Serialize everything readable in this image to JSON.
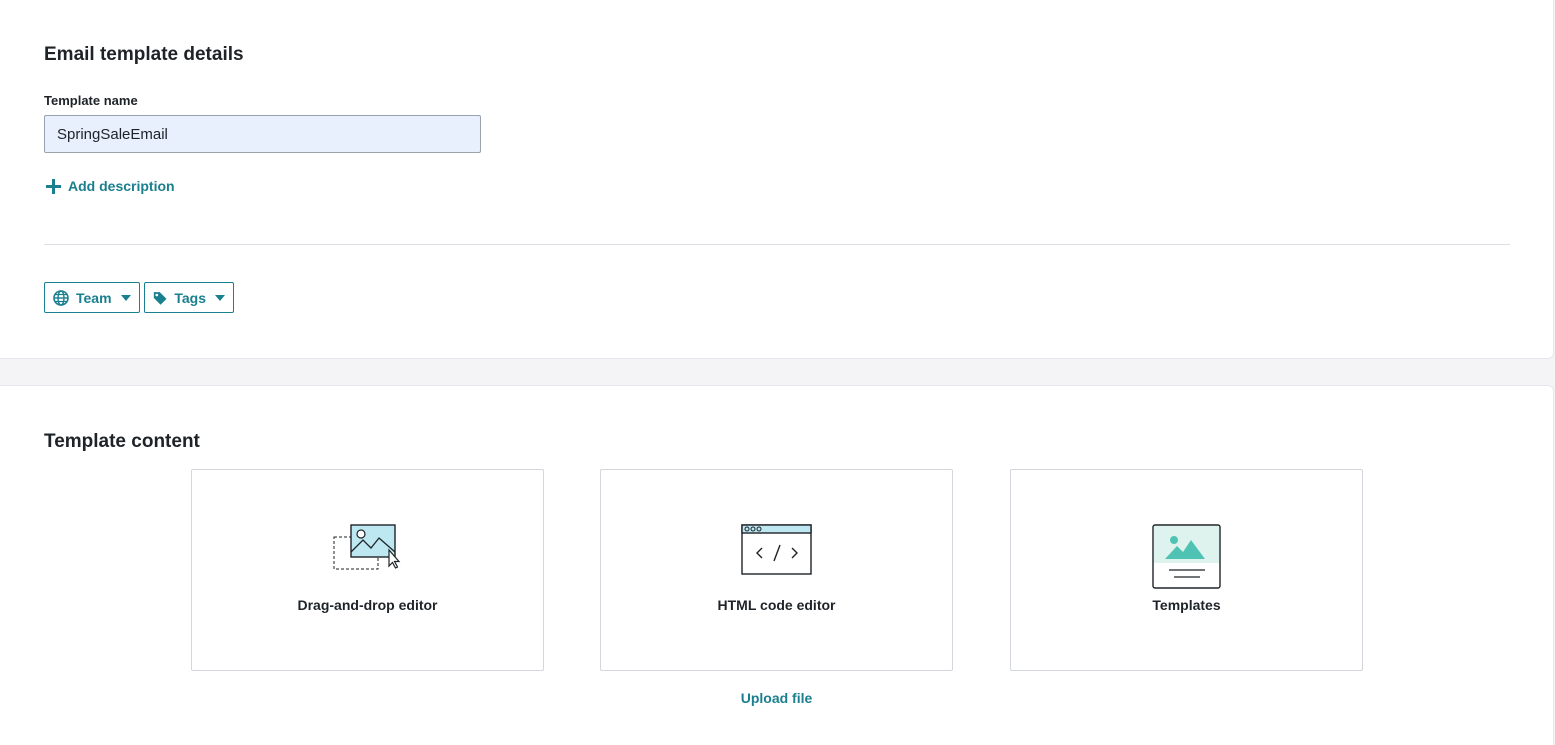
{
  "details": {
    "title": "Email template details",
    "template_name_label": "Template name",
    "template_name_value": "SpringSaleEmail",
    "add_description_label": "Add description",
    "team_label": "Team",
    "tags_label": "Tags"
  },
  "content": {
    "title": "Template content",
    "options": [
      {
        "label": "Drag-and-drop editor",
        "icon": "drag-drop-image-icon"
      },
      {
        "label": "HTML code editor",
        "icon": "code-window-icon"
      },
      {
        "label": "Templates",
        "icon": "template-image-icon"
      }
    ],
    "upload_label": "Upload file"
  },
  "colors": {
    "accent": "#1a7f8e",
    "icon_fill": "#bde8f2",
    "template_fill": "#dff3ee",
    "template_accent": "#4fc3b3"
  }
}
